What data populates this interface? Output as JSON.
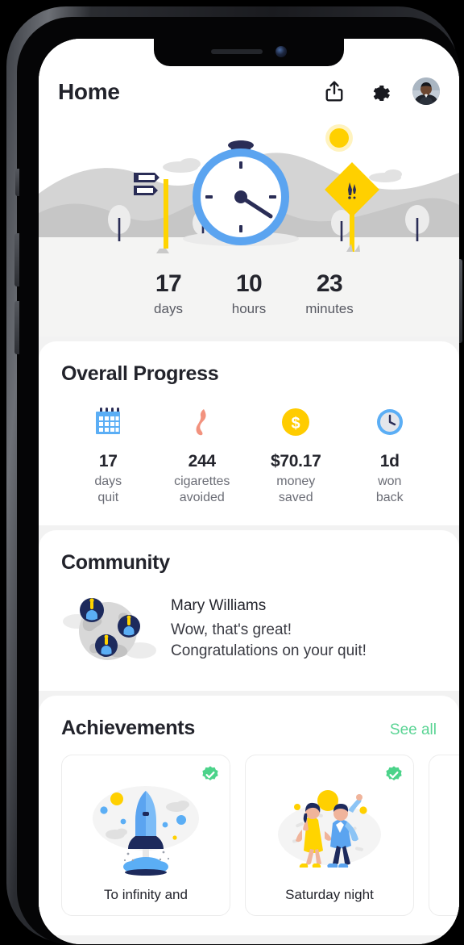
{
  "header": {
    "title": "Home",
    "share_icon": "share-icon",
    "settings_icon": "gear-icon",
    "avatar": "user-avatar"
  },
  "hero": {
    "illustration": "stopwatch-landscape-illustration",
    "colors": {
      "clock_ring": "#5BA4F0",
      "clock_hand": "#2A2D56",
      "sun": "#FFD000",
      "post": "#FFD400",
      "hill": "#CFCFCF"
    }
  },
  "timer": {
    "units": [
      {
        "value": "17",
        "label": "days"
      },
      {
        "value": "10",
        "label": "hours"
      },
      {
        "value": "23",
        "label": "minutes"
      }
    ]
  },
  "overall_progress": {
    "title": "Overall Progress",
    "stats": [
      {
        "icon": "calendar-icon",
        "value": "17",
        "label_line1": "days",
        "label_line2": "quit",
        "color": "#5BAEF5"
      },
      {
        "icon": "smoke-flame-icon",
        "value": "244",
        "label_line1": "cigarettes",
        "label_line2": "avoided",
        "color": "#F2927E"
      },
      {
        "icon": "money-coin-icon",
        "value": "$70.17",
        "label_line1": "money",
        "label_line2": "saved",
        "color": "#FFCC00"
      },
      {
        "icon": "clock-icon",
        "value": "1d",
        "label_line1": "won",
        "label_line2": "back",
        "color": "#5BAEF5"
      }
    ]
  },
  "community": {
    "title": "Community",
    "illustration": "globe-with-members-icon",
    "author": "Mary Williams",
    "message_line1": "Wow, that's great!",
    "message_line2": "Congratulations on your quit!"
  },
  "achievements": {
    "title": "Achievements",
    "see_all_label": "See all",
    "cards": [
      {
        "illustration": "rocket-launch-illustration",
        "name": "To infinity and",
        "badge": "verified-check-badge",
        "unlocked": true
      },
      {
        "illustration": "dancing-couple-illustration",
        "name": "Saturday night",
        "badge": "verified-check-badge",
        "unlocked": true
      },
      {
        "illustration": "partial-card",
        "name": "",
        "badge": "",
        "unlocked": false
      }
    ]
  },
  "theme": {
    "accent_green": "#5AD494",
    "accent_blue": "#5BA4F0",
    "accent_yellow": "#FFCC00",
    "text_dark": "#24252D",
    "text_muted": "#6B6D76",
    "bg": "#F2F2F2"
  }
}
